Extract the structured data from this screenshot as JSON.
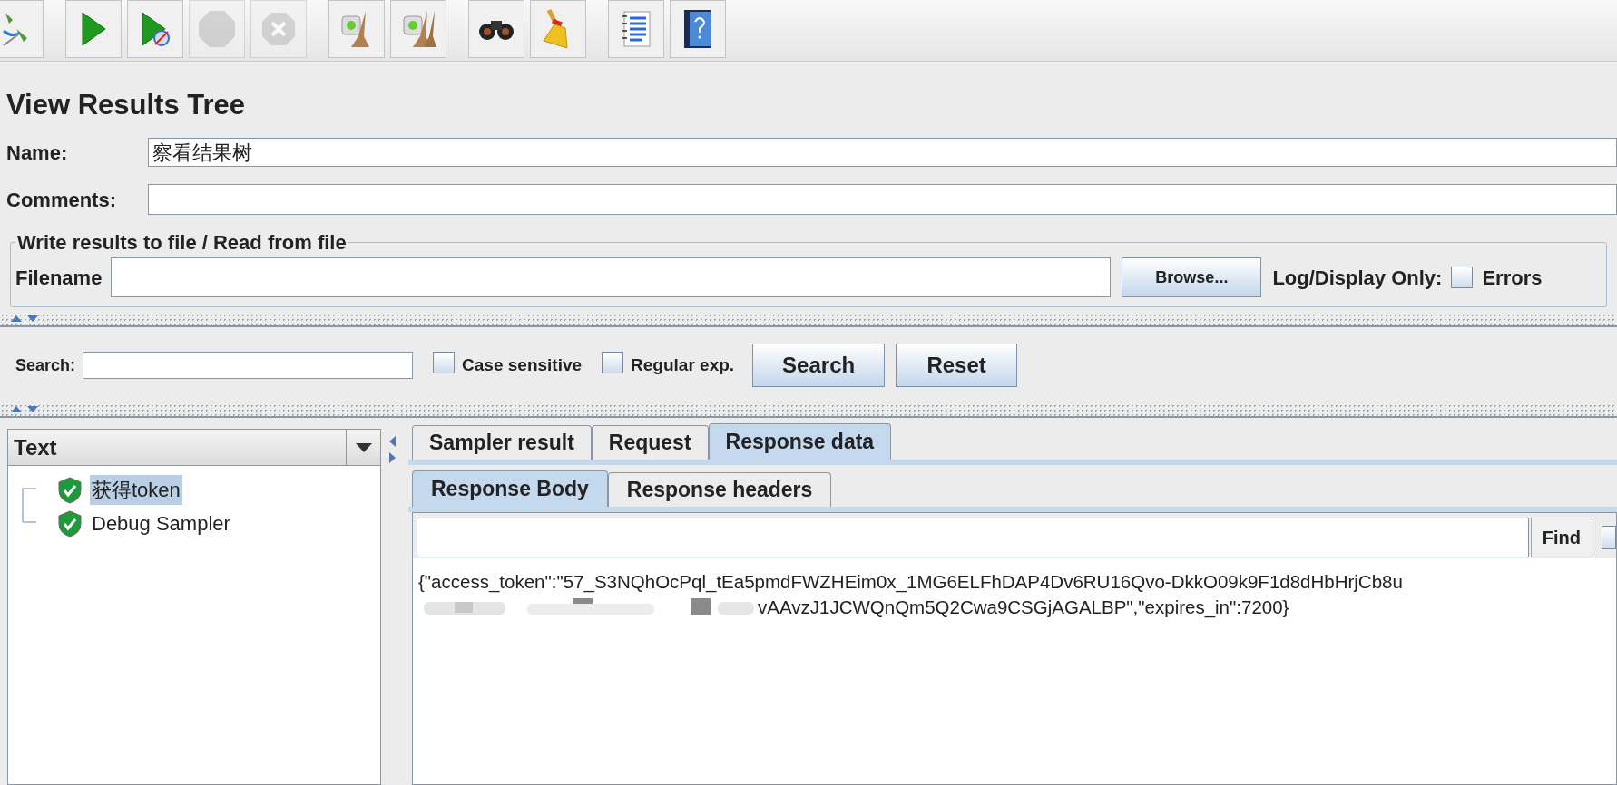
{
  "toolbar": [
    {
      "kind": "remote",
      "disabled": false
    },
    {
      "kind": "start",
      "disabled": false
    },
    {
      "kind": "start-no-pause",
      "disabled": false
    },
    {
      "kind": "stop",
      "disabled": true
    },
    {
      "kind": "shutdown",
      "disabled": true
    },
    {
      "kind": "clear",
      "disabled": false
    },
    {
      "kind": "clear-all",
      "disabled": false
    },
    {
      "kind": "search",
      "disabled": false
    },
    {
      "kind": "reset-search",
      "disabled": false
    },
    {
      "kind": "function-helper",
      "disabled": false
    },
    {
      "kind": "help",
      "disabled": false
    }
  ],
  "title": "View Results Tree",
  "name": {
    "label": "Name:",
    "value": "察看结果树"
  },
  "comments": {
    "label": "Comments:"
  },
  "file_group": {
    "legend": "Write results to file / Read from file",
    "filename_label": "Filename",
    "browse": "Browse...",
    "log_label": "Log/Display Only:",
    "errors": {
      "label": "Errors",
      "checked": false
    }
  },
  "search": {
    "label": "Search:",
    "case_sensitive": {
      "label": "Case sensitive",
      "checked": false
    },
    "regular_exp": {
      "label": "Regular exp.",
      "checked": false
    },
    "search_button": "Search",
    "reset_button": "Reset"
  },
  "renderer": {
    "value": "Text"
  },
  "tree": [
    {
      "label": "获得token",
      "selected": true,
      "success": true
    },
    {
      "label": "Debug Sampler",
      "selected": false,
      "success": true
    }
  ],
  "tabs": [
    {
      "label": "Sampler result",
      "selected": false
    },
    {
      "label": "Request",
      "selected": false
    },
    {
      "label": "Response data",
      "selected": true
    }
  ],
  "subtabs": [
    {
      "label": "Response Body",
      "selected": true
    },
    {
      "label": "Response headers",
      "selected": false
    }
  ],
  "find_button": "Find",
  "find_checkbox": {
    "checked": false
  },
  "response_lines": [
    "{\"access_token\":\"57_S3NQhOcPql_tEa5pmdFWZHEim0x_1MG6ELFhDAP4Dv6RU16Qvo-DkkO09k9F1d8dHbHrjCb8u",
    "vAAvzJ1JCWQnQm5Q2Cwa9CSGjAGALBP\",\"expires_in\":7200}"
  ]
}
